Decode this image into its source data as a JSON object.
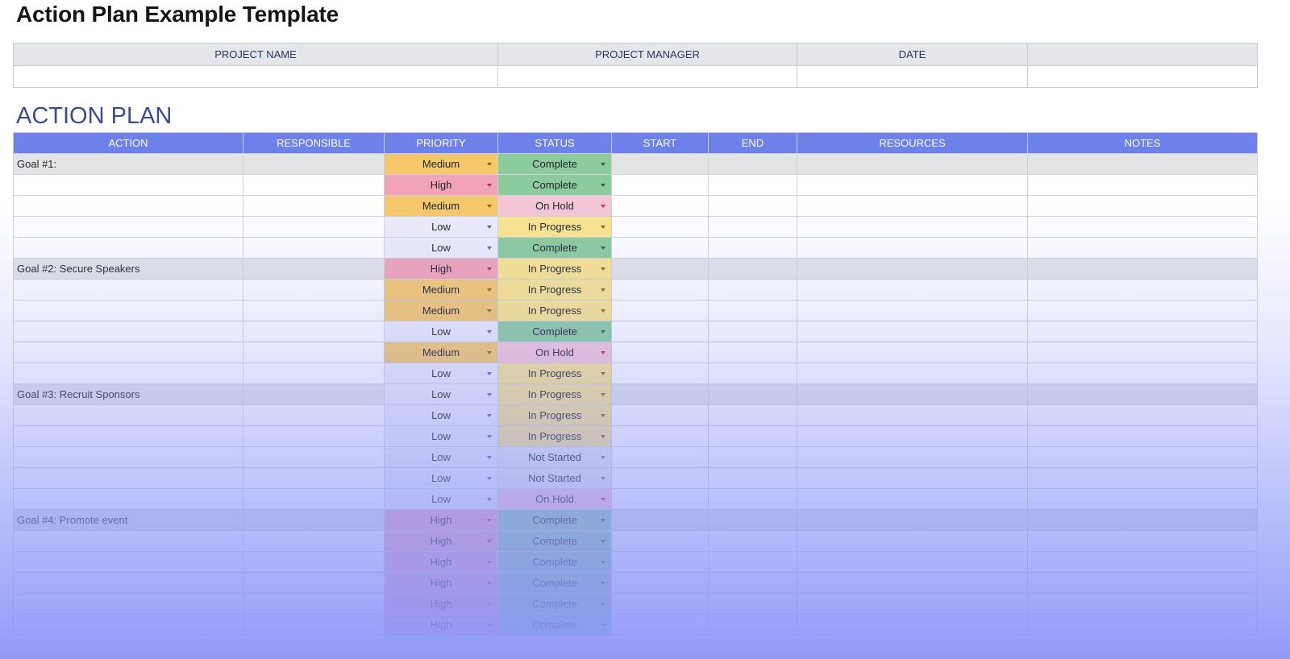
{
  "page": {
    "title": "Action Plan Example Template"
  },
  "project": {
    "headers": [
      "PROJECT NAME",
      "PROJECT MANAGER",
      "DATE",
      ""
    ],
    "values": [
      "",
      "",
      "",
      ""
    ]
  },
  "action_plan": {
    "title": "ACTION PLAN",
    "columns": [
      "ACTION",
      "RESPONSIBLE",
      "PRIORITY",
      "STATUS",
      "START",
      "END",
      "RESOURCES",
      "NOTES"
    ],
    "rows": [
      {
        "goal": true,
        "action": "Goal #1:",
        "priority": "Medium",
        "status": "Complete"
      },
      {
        "goal": false,
        "action": "",
        "priority": "High",
        "status": "Complete"
      },
      {
        "goal": false,
        "action": "",
        "priority": "Medium",
        "status": "On Hold"
      },
      {
        "goal": false,
        "action": "",
        "priority": "Low",
        "status": "In Progress"
      },
      {
        "goal": false,
        "action": "",
        "priority": "Low",
        "status": "Complete"
      },
      {
        "goal": true,
        "action": "Goal #2: Secure Speakers",
        "priority": "High",
        "status": "In Progress"
      },
      {
        "goal": false,
        "action": "",
        "priority": "Medium",
        "status": "In Progress"
      },
      {
        "goal": false,
        "action": "",
        "priority": "Medium",
        "status": "In Progress"
      },
      {
        "goal": false,
        "action": "",
        "priority": "Low",
        "status": "Complete"
      },
      {
        "goal": false,
        "action": "",
        "priority": "Medium",
        "status": "On Hold"
      },
      {
        "goal": false,
        "action": "",
        "priority": "Low",
        "status": "In Progress"
      },
      {
        "goal": true,
        "action": "Goal #3: Recruit Sponsors",
        "priority": "Low",
        "status": "In Progress"
      },
      {
        "goal": false,
        "action": "",
        "priority": "Low",
        "status": "In Progress"
      },
      {
        "goal": false,
        "action": "",
        "priority": "Low",
        "status": "In Progress"
      },
      {
        "goal": false,
        "action": "",
        "priority": "Low",
        "status": "Not Started"
      },
      {
        "goal": false,
        "action": "",
        "priority": "Low",
        "status": "Not Started"
      },
      {
        "goal": false,
        "action": "",
        "priority": "Low",
        "status": "On Hold"
      },
      {
        "goal": true,
        "action": "Goal #4: Promote event",
        "priority": "High",
        "status": "Complete"
      },
      {
        "goal": false,
        "action": "",
        "priority": "High",
        "status": "Complete"
      },
      {
        "goal": false,
        "action": "",
        "priority": "High",
        "status": "Complete"
      },
      {
        "goal": false,
        "action": "",
        "priority": "High",
        "status": "Complete"
      },
      {
        "goal": false,
        "action": "",
        "priority": "High",
        "status": "Complete"
      },
      {
        "goal": false,
        "action": "",
        "priority": "High",
        "status": "Complete"
      }
    ]
  },
  "colors": {
    "header_blue": "#6e80ea",
    "section_title": "#3c4a8e",
    "priority_high": "#f1a4b7",
    "priority_medium": "#f6c86c",
    "priority_low": "#ececf8",
    "status_complete": "#8ccc9c",
    "status_in_progress": "#fae58c",
    "status_on_hold": "#f4c6d6",
    "status_not_started": "#e8e8ee"
  }
}
